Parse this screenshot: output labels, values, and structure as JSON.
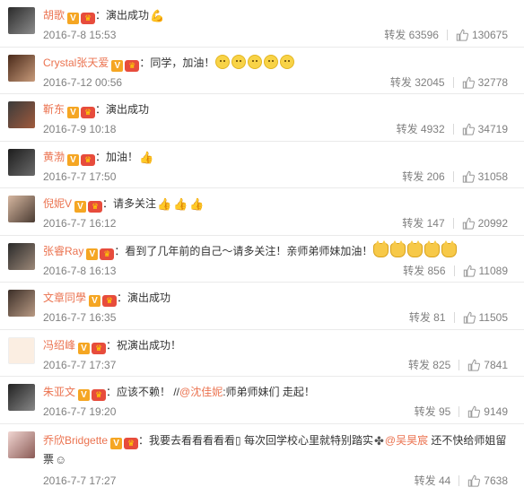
{
  "comments": [
    {
      "name": "胡歌",
      "text_before": "：演出成功",
      "text_after": "",
      "emoji": "arm-flex",
      "emoji_count": 1,
      "mention": "",
      "time": "2016-7-8 15:53",
      "repost": "转发 63596",
      "likes": "130675",
      "crown": true
    },
    {
      "name": "Crystal张天爱",
      "text_before": "：同学，加油！",
      "text_after": "",
      "emoji": "smile",
      "emoji_count": 5,
      "mention": "",
      "time": "2016-7-12 00:56",
      "repost": "转发 32045",
      "likes": "32778",
      "crown": true
    },
    {
      "name": "靳东",
      "text_before": "：演出成功",
      "text_after": "",
      "emoji": "",
      "emoji_count": 0,
      "mention": "",
      "time": "2016-7-9 10:18",
      "repost": "转发 4932",
      "likes": "34719",
      "crown": true
    },
    {
      "name": "黄渤",
      "text_before": "：加油！",
      "text_after": "",
      "emoji": "thumbs-up",
      "emoji_count": 1,
      "mention": "",
      "time": "2016-7-7 17:50",
      "repost": "转发 206",
      "likes": "31058",
      "crown": true
    },
    {
      "name": "倪妮V",
      "text_before": "：请多关注",
      "text_after": "",
      "emoji": "thumbs-up",
      "emoji_count": 3,
      "mention": "",
      "time": "2016-7-7 16:12",
      "repost": "转发 147",
      "likes": "20992",
      "crown": true
    },
    {
      "name": "张睿Ray",
      "text_before": "：看到了几年前的自己～请多关注！亲师弟师妹加油！",
      "text_after": "",
      "emoji": "cat-face",
      "emoji_count": 5,
      "mention": "",
      "time": "2016-7-8 16:13",
      "repost": "转发 856",
      "likes": "11089",
      "crown": true
    },
    {
      "name": "文章同學",
      "text_before": "：演出成功",
      "text_after": "",
      "emoji": "",
      "emoji_count": 0,
      "mention": "",
      "time": "2016-7-7 16:35",
      "repost": "转发 81",
      "likes": "11505",
      "crown": true
    },
    {
      "name": "冯绍峰",
      "text_before": "：祝演出成功！",
      "text_after": "",
      "emoji": "",
      "emoji_count": 0,
      "mention": "",
      "time": "2016-7-7 17:37",
      "repost": "转发 825",
      "likes": "7841",
      "crown": true
    },
    {
      "name": "朱亚文",
      "text_before": "：应该不赖！ //",
      "text_after": ":师弟师妹们 走起！",
      "emoji": "",
      "emoji_count": 0,
      "mention": "@沈佳妮",
      "time": "2016-7-7 19:20",
      "repost": "转发 95",
      "likes": "9149",
      "crown": true
    },
    {
      "name": "乔欣Bridgette",
      "text_before": "：我要去看看看看看▯ 每次回学校心里就特别踏实",
      "text_after": " 还不快给师姐留票",
      "emoji": "",
      "emoji_count": 0,
      "mention": "@吴昊宸",
      "time": "2016-7-7 17:27",
      "repost": "转发 44",
      "likes": "7638",
      "crown": true
    }
  ],
  "icons": {
    "verified": "verified-v-icon",
    "member": "member-crown-icon",
    "like": "thumbs-up-icon"
  },
  "colors": {
    "name": "#eb7350",
    "meta": "#808080",
    "text": "#333333",
    "verified": "#f5a623"
  }
}
